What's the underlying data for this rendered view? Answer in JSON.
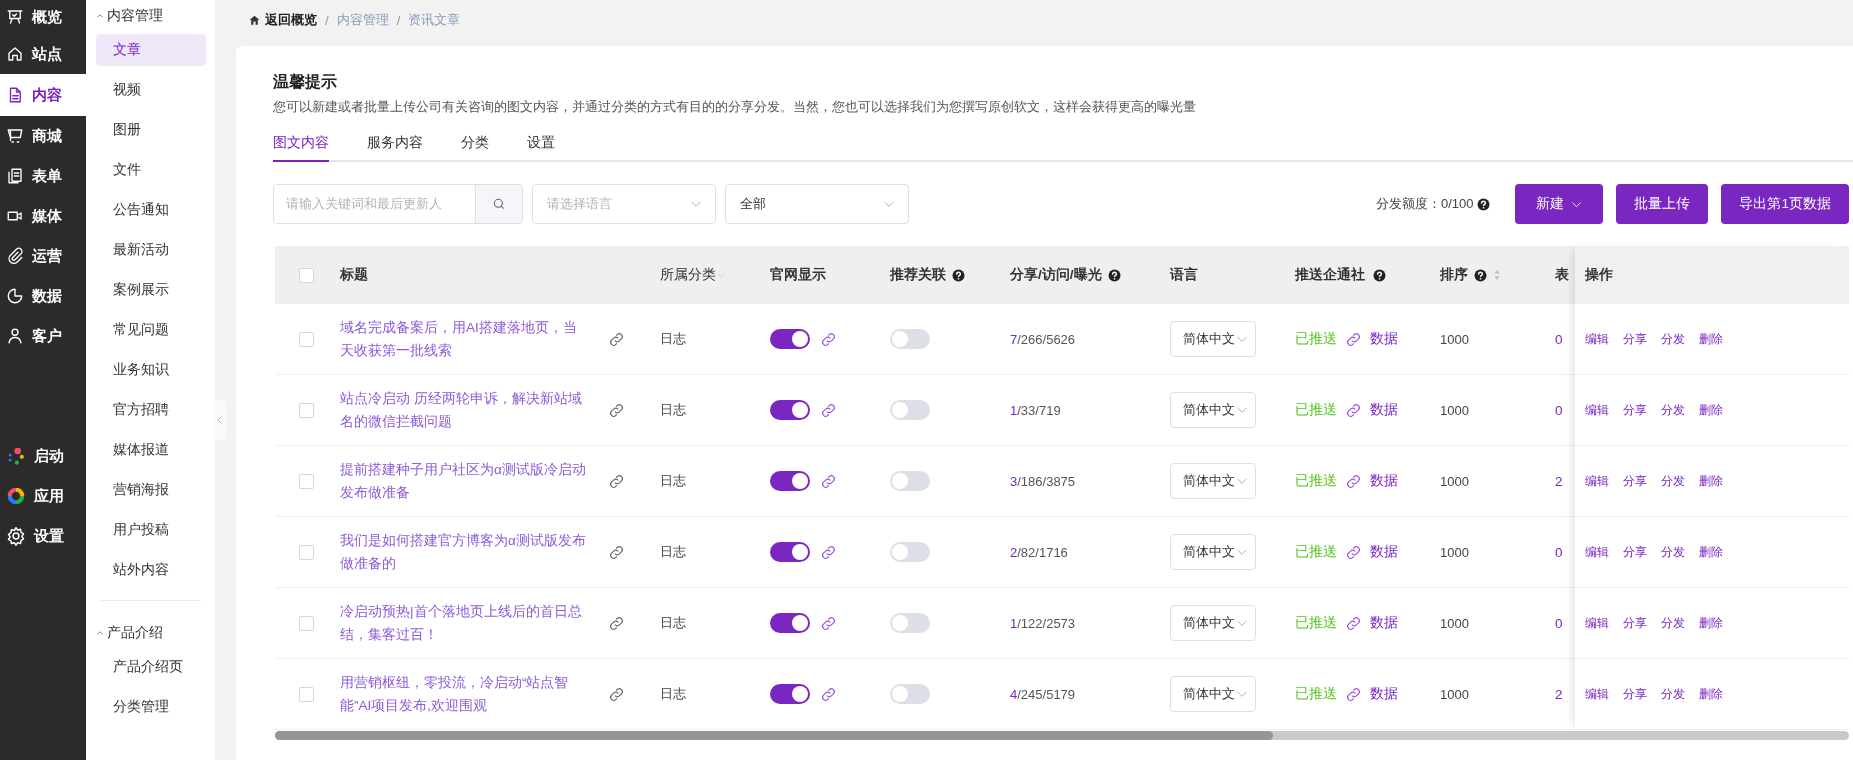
{
  "rail": {
    "items": [
      {
        "label": "概览",
        "selected": false
      },
      {
        "label": "站点",
        "selected": false
      },
      {
        "label": "内容",
        "selected": true
      },
      {
        "label": "商城",
        "selected": false
      },
      {
        "label": "表单",
        "selected": false
      },
      {
        "label": "媒体",
        "selected": false
      },
      {
        "label": "运营",
        "selected": false
      },
      {
        "label": "数据",
        "selected": false
      },
      {
        "label": "客户",
        "selected": false
      }
    ],
    "bottom_items": [
      {
        "label": "启动",
        "selected": false
      },
      {
        "label": "应用",
        "selected": false
      },
      {
        "label": "设置",
        "selected": false
      }
    ]
  },
  "submenu": [
    {
      "title": "内容管理",
      "expanded": true,
      "items": [
        {
          "label": "文章",
          "selected": true
        },
        {
          "label": "视频",
          "selected": false
        },
        {
          "label": "图册",
          "selected": false
        },
        {
          "label": "文件",
          "selected": false
        },
        {
          "label": "公告通知",
          "selected": false
        },
        {
          "label": "最新活动",
          "selected": false
        },
        {
          "label": "案例展示",
          "selected": false
        },
        {
          "label": "常见问题",
          "selected": false
        },
        {
          "label": "业务知识",
          "selected": false
        },
        {
          "label": "官方招聘",
          "selected": false
        },
        {
          "label": "媒体报道",
          "selected": false
        },
        {
          "label": "营销海报",
          "selected": false
        },
        {
          "label": "用户投稿",
          "selected": false
        },
        {
          "label": "站外内容",
          "selected": false
        }
      ]
    },
    {
      "title": "产品介绍",
      "expanded": true,
      "items": [
        {
          "label": "产品介绍页",
          "selected": false
        },
        {
          "label": "分类管理",
          "selected": false
        }
      ]
    }
  ],
  "breadcrumb": {
    "separator": "/",
    "items": [
      "返回概览",
      "内容管理",
      "资讯文章"
    ]
  },
  "notice": {
    "title": "温馨提示",
    "text": "您可以新建或者批量上传公司有关咨询的图文内容，并通过分类的方式有目的的分享分发。当然，您也可以选择我们为您撰写原创软文，这样会获得更高的曝光量"
  },
  "tabs": [
    {
      "label": "图文内容",
      "selected": true
    },
    {
      "label": "服务内容",
      "selected": false
    },
    {
      "label": "分类",
      "selected": false
    },
    {
      "label": "设置",
      "selected": false
    }
  ],
  "filters": {
    "search": {
      "placeholder": "请输入关键词和最后更新人"
    },
    "language": {
      "placeholder": "请选择语言"
    },
    "category": {
      "value": "全部"
    }
  },
  "quota": "分发额度：0/100",
  "buttons": [
    {
      "label": "新建",
      "kind": "menu"
    },
    {
      "label": "批量上传",
      "kind": "plain"
    },
    {
      "label": "导出第1页数据",
      "kind": "plain"
    }
  ],
  "table": {
    "select_all": {
      "checked": false
    },
    "columns": [
      {
        "label": "标题"
      },
      {
        "label": "所属分类"
      },
      {
        "label": "官网显示"
      },
      {
        "label": "推荐关联"
      },
      {
        "label": "分享/访问/曝光"
      },
      {
        "label": "语言"
      },
      {
        "label": "推送企通社"
      },
      {
        "label": "排序"
      },
      {
        "label": "表"
      },
      {
        "label": "操作"
      }
    ],
    "rows": [
      {
        "checked": false,
        "title": "域名完成备案后，用AI搭建落地页，当天收获第一批线索",
        "category": "日志",
        "published": true,
        "recommended": false,
        "stats": "7/266/5626",
        "language": "简体中文",
        "push_status": "已推送",
        "data_link": "数据",
        "sort": "1000",
        "forms": "0",
        "actions": [
          "编辑",
          "分享",
          "分发",
          "删除"
        ]
      },
      {
        "checked": false,
        "title": "站点冷启动 历经两轮申诉，解决新站域名的微信拦截问题",
        "category": "日志",
        "published": true,
        "recommended": false,
        "stats": "1/33/719",
        "language": "简体中文",
        "push_status": "已推送",
        "data_link": "数据",
        "sort": "1000",
        "forms": "0",
        "actions": [
          "编辑",
          "分享",
          "分发",
          "删除"
        ]
      },
      {
        "checked": false,
        "title": "提前搭建种子用户社区为α测试版冷启动发布做准备",
        "category": "日志",
        "published": true,
        "recommended": false,
        "stats": "3/186/3875",
        "language": "简体中文",
        "push_status": "已推送",
        "data_link": "数据",
        "sort": "1000",
        "forms": "2",
        "actions": [
          "编辑",
          "分享",
          "分发",
          "删除"
        ]
      },
      {
        "checked": false,
        "title": "我们是如何搭建官方博客为α测试版发布做准备的",
        "category": "日志",
        "published": true,
        "recommended": false,
        "stats": "2/82/1716",
        "language": "简体中文",
        "push_status": "已推送",
        "data_link": "数据",
        "sort": "1000",
        "forms": "0",
        "actions": [
          "编辑",
          "分享",
          "分发",
          "删除"
        ]
      },
      {
        "checked": false,
        "title": "冷启动预热|首个落地页上线后的首日总结，集客过百！",
        "category": "日志",
        "published": true,
        "recommended": false,
        "stats": "1/122/2573",
        "language": "简体中文",
        "push_status": "已推送",
        "data_link": "数据",
        "sort": "1000",
        "forms": "0",
        "actions": [
          "编辑",
          "分享",
          "分发",
          "删除"
        ]
      },
      {
        "checked": false,
        "title": "用营销枢纽，零投流，冷启动“站点智能”AI项目发布,欢迎围观",
        "category": "日志",
        "published": true,
        "recommended": false,
        "stats": "4/245/5179",
        "language": "简体中文",
        "push_status": "已推送",
        "data_link": "数据",
        "sort": "1000",
        "forms": "2",
        "actions": [
          "编辑",
          "分享",
          "分发",
          "删除"
        ]
      }
    ]
  }
}
